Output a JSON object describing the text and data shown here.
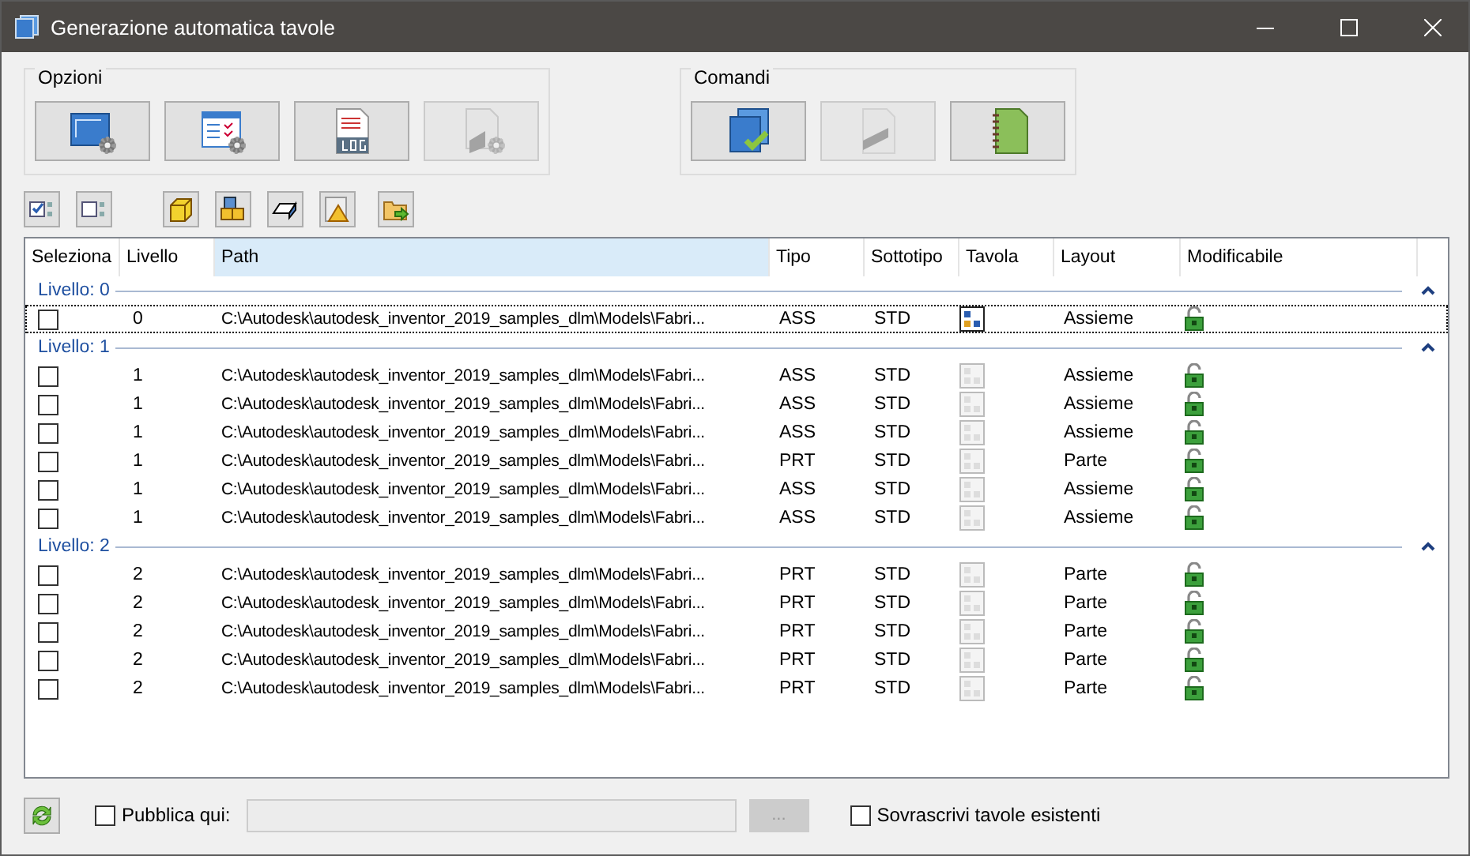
{
  "window": {
    "title": "Generazione automatica tavole"
  },
  "opzioni": {
    "title": "Opzioni",
    "buttons": [
      {
        "kind": "sheet-settings",
        "disabled": false
      },
      {
        "kind": "list-settings",
        "disabled": false
      },
      {
        "kind": "log",
        "disabled": false
      },
      {
        "kind": "frame-settings",
        "disabled": true
      }
    ]
  },
  "comandi": {
    "title": "Comandi",
    "buttons": [
      {
        "kind": "sheets-check",
        "disabled": false
      },
      {
        "kind": "frame-sheet",
        "disabled": true
      },
      {
        "kind": "notebook",
        "disabled": false
      }
    ]
  },
  "toolbar": [
    {
      "kind": "check-all"
    },
    {
      "kind": "uncheck-all"
    },
    {
      "kind": "part"
    },
    {
      "kind": "assembly"
    },
    {
      "kind": "sheet-metal"
    },
    {
      "kind": "warning"
    },
    {
      "kind": "folder"
    }
  ],
  "table": {
    "columns": [
      {
        "label": "Seleziona",
        "selected": false
      },
      {
        "label": "Livello",
        "selected": false
      },
      {
        "label": "Path",
        "selected": true
      },
      {
        "label": "Tipo",
        "selected": false
      },
      {
        "label": "Sottotipo",
        "selected": false
      },
      {
        "label": "Tavola",
        "selected": false
      },
      {
        "label": "Layout",
        "selected": false
      },
      {
        "label": "Modificabile",
        "selected": false
      }
    ],
    "groups": [
      {
        "label": "Livello: 0",
        "expanded": true,
        "rows": [
          {
            "checked": false,
            "focused": true,
            "level": "0",
            "path": "C:\\Autodesk\\autodesk_inventor_2019_samples_dlm\\Models\\Fabri...",
            "tipo": "ASS",
            "sottotipo": "STD",
            "has_sheet": true,
            "layout": "Assieme",
            "editable": true
          }
        ]
      },
      {
        "label": "Livello: 1",
        "expanded": true,
        "rows": [
          {
            "checked": false,
            "focused": false,
            "level": "1",
            "path": "C:\\Autodesk\\autodesk_inventor_2019_samples_dlm\\Models\\Fabri...",
            "tipo": "ASS",
            "sottotipo": "STD",
            "has_sheet": false,
            "layout": "Assieme",
            "editable": true
          },
          {
            "checked": false,
            "focused": false,
            "level": "1",
            "path": "C:\\Autodesk\\autodesk_inventor_2019_samples_dlm\\Models\\Fabri...",
            "tipo": "ASS",
            "sottotipo": "STD",
            "has_sheet": false,
            "layout": "Assieme",
            "editable": true
          },
          {
            "checked": false,
            "focused": false,
            "level": "1",
            "path": "C:\\Autodesk\\autodesk_inventor_2019_samples_dlm\\Models\\Fabri...",
            "tipo": "ASS",
            "sottotipo": "STD",
            "has_sheet": false,
            "layout": "Assieme",
            "editable": true
          },
          {
            "checked": false,
            "focused": false,
            "level": "1",
            "path": "C:\\Autodesk\\autodesk_inventor_2019_samples_dlm\\Models\\Fabri...",
            "tipo": "PRT",
            "sottotipo": "STD",
            "has_sheet": false,
            "layout": "Parte",
            "editable": true
          },
          {
            "checked": false,
            "focused": false,
            "level": "1",
            "path": "C:\\Autodesk\\autodesk_inventor_2019_samples_dlm\\Models\\Fabri...",
            "tipo": "ASS",
            "sottotipo": "STD",
            "has_sheet": false,
            "layout": "Assieme",
            "editable": true
          },
          {
            "checked": false,
            "focused": false,
            "level": "1",
            "path": "C:\\Autodesk\\autodesk_inventor_2019_samples_dlm\\Models\\Fabri...",
            "tipo": "ASS",
            "sottotipo": "STD",
            "has_sheet": false,
            "layout": "Assieme",
            "editable": true
          }
        ]
      },
      {
        "label": "Livello: 2",
        "expanded": true,
        "rows": [
          {
            "checked": false,
            "focused": false,
            "level": "2",
            "path": "C:\\Autodesk\\autodesk_inventor_2019_samples_dlm\\Models\\Fabri...",
            "tipo": "PRT",
            "sottotipo": "STD",
            "has_sheet": false,
            "layout": "Parte",
            "editable": true
          },
          {
            "checked": false,
            "focused": false,
            "level": "2",
            "path": "C:\\Autodesk\\autodesk_inventor_2019_samples_dlm\\Models\\Fabri...",
            "tipo": "PRT",
            "sottotipo": "STD",
            "has_sheet": false,
            "layout": "Parte",
            "editable": true
          },
          {
            "checked": false,
            "focused": false,
            "level": "2",
            "path": "C:\\Autodesk\\autodesk_inventor_2019_samples_dlm\\Models\\Fabri...",
            "tipo": "PRT",
            "sottotipo": "STD",
            "has_sheet": false,
            "layout": "Parte",
            "editable": true
          },
          {
            "checked": false,
            "focused": false,
            "level": "2",
            "path": "C:\\Autodesk\\autodesk_inventor_2019_samples_dlm\\Models\\Fabri...",
            "tipo": "PRT",
            "sottotipo": "STD",
            "has_sheet": false,
            "layout": "Parte",
            "editable": true
          },
          {
            "checked": false,
            "focused": false,
            "level": "2",
            "path": "C:\\Autodesk\\autodesk_inventor_2019_samples_dlm\\Models\\Fabri...",
            "tipo": "PRT",
            "sottotipo": "STD",
            "has_sheet": false,
            "layout": "Parte",
            "editable": true
          }
        ]
      }
    ]
  },
  "footer": {
    "publish": {
      "label": "Pubblica qui:",
      "checked": false
    },
    "browse": {
      "label": "...",
      "disabled": true
    },
    "overwrite": {
      "label": "Sovrascrivi tavole esistenti",
      "checked": false
    }
  }
}
